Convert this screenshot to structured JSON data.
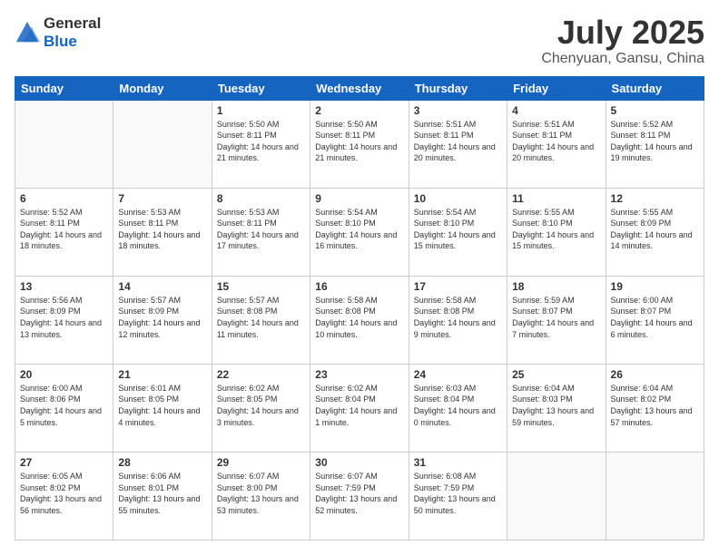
{
  "header": {
    "logo": {
      "general": "General",
      "blue": "Blue"
    },
    "month": "July 2025",
    "location": "Chenyuan, Gansu, China"
  },
  "weekdays": [
    "Sunday",
    "Monday",
    "Tuesday",
    "Wednesday",
    "Thursday",
    "Friday",
    "Saturday"
  ],
  "weeks": [
    [
      {
        "day": null
      },
      {
        "day": null
      },
      {
        "day": 1,
        "sunrise": "5:50 AM",
        "sunset": "8:11 PM",
        "daylight": "14 hours and 21 minutes."
      },
      {
        "day": 2,
        "sunrise": "5:50 AM",
        "sunset": "8:11 PM",
        "daylight": "14 hours and 21 minutes."
      },
      {
        "day": 3,
        "sunrise": "5:51 AM",
        "sunset": "8:11 PM",
        "daylight": "14 hours and 20 minutes."
      },
      {
        "day": 4,
        "sunrise": "5:51 AM",
        "sunset": "8:11 PM",
        "daylight": "14 hours and 20 minutes."
      },
      {
        "day": 5,
        "sunrise": "5:52 AM",
        "sunset": "8:11 PM",
        "daylight": "14 hours and 19 minutes."
      }
    ],
    [
      {
        "day": 6,
        "sunrise": "5:52 AM",
        "sunset": "8:11 PM",
        "daylight": "14 hours and 18 minutes."
      },
      {
        "day": 7,
        "sunrise": "5:53 AM",
        "sunset": "8:11 PM",
        "daylight": "14 hours and 18 minutes."
      },
      {
        "day": 8,
        "sunrise": "5:53 AM",
        "sunset": "8:11 PM",
        "daylight": "14 hours and 17 minutes."
      },
      {
        "day": 9,
        "sunrise": "5:54 AM",
        "sunset": "8:10 PM",
        "daylight": "14 hours and 16 minutes."
      },
      {
        "day": 10,
        "sunrise": "5:54 AM",
        "sunset": "8:10 PM",
        "daylight": "14 hours and 15 minutes."
      },
      {
        "day": 11,
        "sunrise": "5:55 AM",
        "sunset": "8:10 PM",
        "daylight": "14 hours and 15 minutes."
      },
      {
        "day": 12,
        "sunrise": "5:55 AM",
        "sunset": "8:09 PM",
        "daylight": "14 hours and 14 minutes."
      }
    ],
    [
      {
        "day": 13,
        "sunrise": "5:56 AM",
        "sunset": "8:09 PM",
        "daylight": "14 hours and 13 minutes."
      },
      {
        "day": 14,
        "sunrise": "5:57 AM",
        "sunset": "8:09 PM",
        "daylight": "14 hours and 12 minutes."
      },
      {
        "day": 15,
        "sunrise": "5:57 AM",
        "sunset": "8:08 PM",
        "daylight": "14 hours and 11 minutes."
      },
      {
        "day": 16,
        "sunrise": "5:58 AM",
        "sunset": "8:08 PM",
        "daylight": "14 hours and 10 minutes."
      },
      {
        "day": 17,
        "sunrise": "5:58 AM",
        "sunset": "8:08 PM",
        "daylight": "14 hours and 9 minutes."
      },
      {
        "day": 18,
        "sunrise": "5:59 AM",
        "sunset": "8:07 PM",
        "daylight": "14 hours and 7 minutes."
      },
      {
        "day": 19,
        "sunrise": "6:00 AM",
        "sunset": "8:07 PM",
        "daylight": "14 hours and 6 minutes."
      }
    ],
    [
      {
        "day": 20,
        "sunrise": "6:00 AM",
        "sunset": "8:06 PM",
        "daylight": "14 hours and 5 minutes."
      },
      {
        "day": 21,
        "sunrise": "6:01 AM",
        "sunset": "8:05 PM",
        "daylight": "14 hours and 4 minutes."
      },
      {
        "day": 22,
        "sunrise": "6:02 AM",
        "sunset": "8:05 PM",
        "daylight": "14 hours and 3 minutes."
      },
      {
        "day": 23,
        "sunrise": "6:02 AM",
        "sunset": "8:04 PM",
        "daylight": "14 hours and 1 minute."
      },
      {
        "day": 24,
        "sunrise": "6:03 AM",
        "sunset": "8:04 PM",
        "daylight": "14 hours and 0 minutes."
      },
      {
        "day": 25,
        "sunrise": "6:04 AM",
        "sunset": "8:03 PM",
        "daylight": "13 hours and 59 minutes."
      },
      {
        "day": 26,
        "sunrise": "6:04 AM",
        "sunset": "8:02 PM",
        "daylight": "13 hours and 57 minutes."
      }
    ],
    [
      {
        "day": 27,
        "sunrise": "6:05 AM",
        "sunset": "8:02 PM",
        "daylight": "13 hours and 56 minutes."
      },
      {
        "day": 28,
        "sunrise": "6:06 AM",
        "sunset": "8:01 PM",
        "daylight": "13 hours and 55 minutes."
      },
      {
        "day": 29,
        "sunrise": "6:07 AM",
        "sunset": "8:00 PM",
        "daylight": "13 hours and 53 minutes."
      },
      {
        "day": 30,
        "sunrise": "6:07 AM",
        "sunset": "7:59 PM",
        "daylight": "13 hours and 52 minutes."
      },
      {
        "day": 31,
        "sunrise": "6:08 AM",
        "sunset": "7:59 PM",
        "daylight": "13 hours and 50 minutes."
      },
      {
        "day": null
      },
      {
        "day": null
      }
    ]
  ]
}
